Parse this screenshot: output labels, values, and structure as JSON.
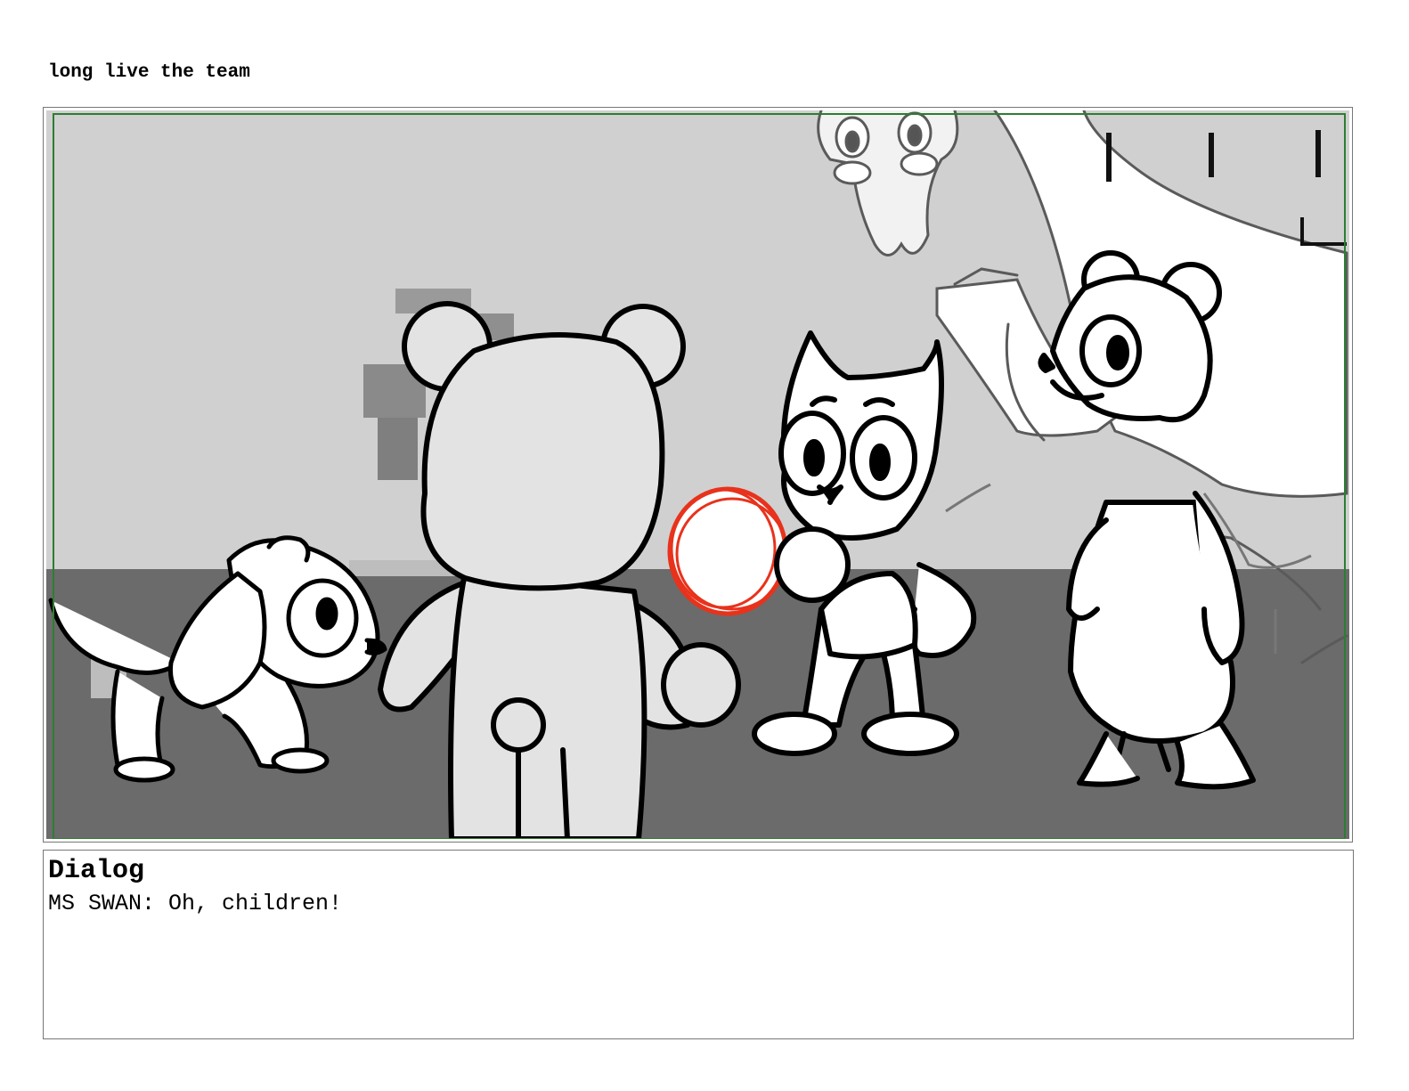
{
  "sheet": {
    "title": "long live the team"
  },
  "panel": {
    "colors": {
      "wall": "#d0d0d0",
      "floor": "#6b6b6b",
      "safe_frame": "#2e7d32",
      "highlight": "#e8321c",
      "ink": "#000000",
      "sketch": "#5a5a5a"
    },
    "characters": [
      "puppy",
      "bear-back-view",
      "cat-kitten",
      "bear-standing",
      "swan-sketch"
    ]
  },
  "dialog": {
    "heading": "Dialog",
    "line": "MS SWAN: Oh, children!"
  }
}
